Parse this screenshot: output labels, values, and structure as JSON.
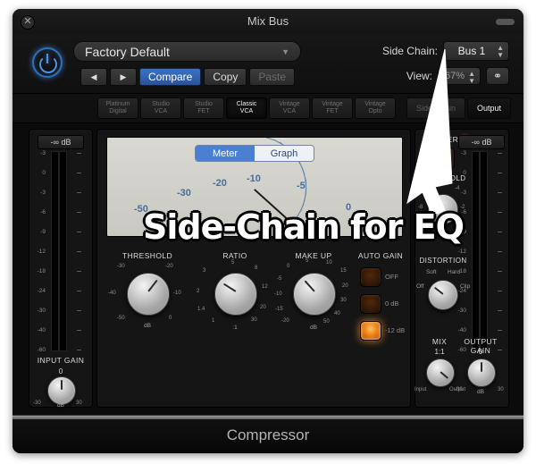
{
  "window": {
    "title": "Mix Bus",
    "close_label": "✕",
    "footer_name": "Compressor"
  },
  "header": {
    "preset": {
      "value": "Factory Default",
      "caret": "▼"
    },
    "prev_label": "◀",
    "next_label": "▶",
    "compare_label": "Compare",
    "copy_label": "Copy",
    "paste_label": "Paste",
    "side_chain_label": "Side Chain:",
    "side_chain_value": "Bus 1",
    "view_label": "View:",
    "view_value": "67%",
    "link_icon": "⚭"
  },
  "tabs": {
    "models": [
      {
        "line1": "Platinum",
        "line2": "Digital",
        "selected": false
      },
      {
        "line1": "Studio",
        "line2": "VCA",
        "selected": false
      },
      {
        "line1": "Studio",
        "line2": "FET",
        "selected": false
      },
      {
        "line1": "Classic",
        "line2": "VCA",
        "selected": true
      },
      {
        "line1": "Vintage",
        "line2": "VCA",
        "selected": false
      },
      {
        "line1": "Vintage",
        "line2": "FET",
        "selected": false
      },
      {
        "line1": "Vintage",
        "line2": "Opto",
        "selected": false
      }
    ],
    "right": [
      {
        "label": "Side Chain",
        "selected": false
      },
      {
        "label": "Output",
        "selected": true
      }
    ]
  },
  "input_meter": {
    "readout": "-∞ dB",
    "scale": [
      "-3",
      "0",
      "-3",
      "-6",
      "-9",
      "-12",
      "-18",
      "-24",
      "-30",
      "-40",
      "-60"
    ]
  },
  "output_meter": {
    "readout": "-∞ dB",
    "scale": [
      "-3",
      "0",
      "-3",
      "-6",
      "-9",
      "-12",
      "-18",
      "-24",
      "-30",
      "-40",
      "-60"
    ]
  },
  "vu": {
    "meter_label": "Meter",
    "graph_label": "Graph",
    "selected": "Meter",
    "scale": [
      "-50",
      "-30",
      "-20",
      "-10",
      "-5",
      "0"
    ]
  },
  "knobs": {
    "threshold": {
      "label": "THRESHOLD",
      "unit": "dB",
      "scale": [
        "-30",
        "-20",
        "-40",
        "-10",
        "-50",
        "0"
      ]
    },
    "ratio": {
      "label": "RATIO",
      "unit": ":1",
      "scale": [
        "5",
        "8",
        "3",
        "12",
        "2",
        "20",
        "1.4",
        "30",
        "1"
      ]
    },
    "makeup": {
      "label": "MAKE UP",
      "unit": "dB",
      "scale": [
        "5",
        "10",
        "0",
        "15",
        "-5",
        "20",
        "-10",
        "30",
        "-15",
        "40",
        "-20",
        "50"
      ]
    },
    "input_gain": {
      "label": "INPUT GAIN",
      "value": "0",
      "unit": "dB",
      "min": "-30",
      "max": "30"
    },
    "output_gain": {
      "label": "OUTPUT GAIN",
      "value": "0",
      "unit": "dB",
      "min": "-30",
      "max": "30"
    },
    "mix": {
      "label": "MIX",
      "value": "1:1",
      "min": "Input",
      "max": "Output"
    },
    "limiter_threshold": {
      "label": "THRESHOLD",
      "unit": "dB",
      "scale": [
        "-6",
        "-4",
        "-8",
        "-2",
        "0"
      ]
    },
    "distortion": {
      "label": "DISTORTION",
      "soft": "Soft",
      "hard": "Hard",
      "off": "Off",
      "clip": "Clip"
    }
  },
  "auto_gain": {
    "label": "AUTO GAIN",
    "options": [
      {
        "label": "OFF",
        "on": false
      },
      {
        "label": "0 dB",
        "on": false
      },
      {
        "label": "-12 dB",
        "on": true
      }
    ]
  },
  "limiter": {
    "label": "LIMITER"
  },
  "annotation": {
    "text": "Side-Chain for EQ"
  },
  "colors": {
    "accent_blue": "#3a72c4",
    "led_on": "#e06a08",
    "power_blue": "#4f93e0"
  }
}
